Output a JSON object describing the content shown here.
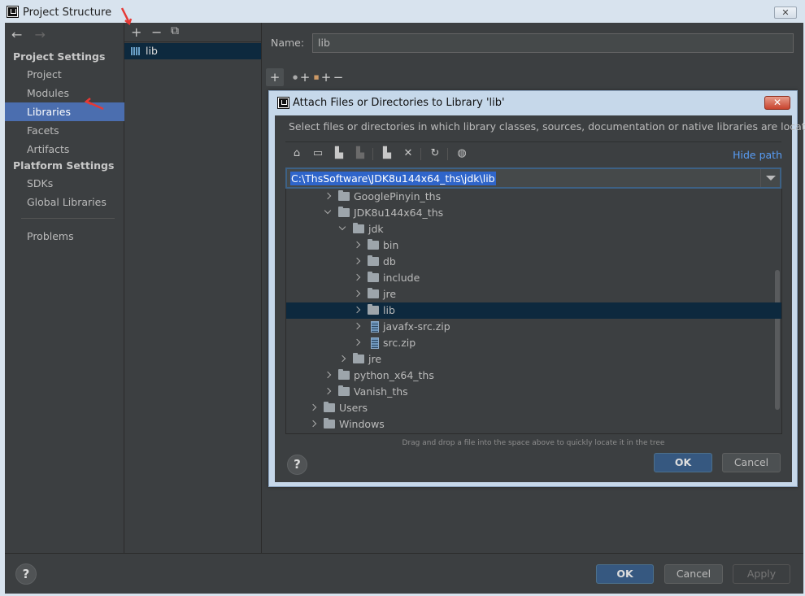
{
  "outer": {
    "title": "Project Structure",
    "close_glyph": "✕"
  },
  "sidebar": {
    "back_glyph": "←",
    "forward_glyph": "→",
    "project_settings_header": "Project Settings",
    "platform_settings_header": "Platform Settings",
    "items": [
      {
        "label": "Project"
      },
      {
        "label": "Modules"
      },
      {
        "label": "Libraries",
        "selected": true
      },
      {
        "label": "Facets"
      },
      {
        "label": "Artifacts"
      },
      {
        "label": "SDKs"
      },
      {
        "label": "Global Libraries"
      },
      {
        "label": "Problems"
      }
    ]
  },
  "middle": {
    "add_glyph": "+",
    "remove_glyph": "−",
    "copy_glyph": "⧉",
    "library_name": "lib"
  },
  "right": {
    "name_label": "Name:",
    "name_value": "lib",
    "toolbar": {
      "add_glyph": "+",
      "add_alt_glyph": "+",
      "add_other_glyph": "+",
      "remove_glyph": "−"
    }
  },
  "dialog": {
    "title": "Attach Files or Directories to Library 'lib'",
    "close_glyph": "✕",
    "description": "Select files or directories in which library classes, sources, documentation or native libraries are located",
    "hide_path": "Hide path",
    "path_value": "C:\\ThsSoftware\\JDK8u144x64_ths\\jdk\\lib",
    "toolbar_icons": [
      "home-icon",
      "desktop-icon",
      "project-folder-icon",
      "module-folder-icon",
      "new-folder-icon",
      "delete-icon",
      "refresh-icon",
      "show-hidden-icon"
    ],
    "tree": [
      {
        "label": "GooglePinyin_ths",
        "level": 2,
        "type": "folder",
        "open": false
      },
      {
        "label": "JDK8u144x64_ths",
        "level": 2,
        "type": "folder",
        "open": true
      },
      {
        "label": "jdk",
        "level": 3,
        "type": "folder",
        "open": true
      },
      {
        "label": "bin",
        "level": 4,
        "type": "folder",
        "open": false
      },
      {
        "label": "db",
        "level": 4,
        "type": "folder",
        "open": false
      },
      {
        "label": "include",
        "level": 4,
        "type": "folder",
        "open": false
      },
      {
        "label": "jre",
        "level": 4,
        "type": "folder",
        "open": false
      },
      {
        "label": "lib",
        "level": 4,
        "type": "folder",
        "open": false,
        "selected": true
      },
      {
        "label": "javafx-src.zip",
        "level": 4,
        "type": "zip",
        "open": false
      },
      {
        "label": "src.zip",
        "level": 4,
        "type": "zip",
        "open": false
      },
      {
        "label": "jre",
        "level": 3,
        "type": "folder",
        "open": false
      },
      {
        "label": "python_x64_ths",
        "level": 2,
        "type": "folder",
        "open": false
      },
      {
        "label": "Vanish_ths",
        "level": 2,
        "type": "folder",
        "open": false
      },
      {
        "label": "Users",
        "level": 1,
        "type": "folder",
        "open": false
      },
      {
        "label": "Windows",
        "level": 1,
        "type": "folder",
        "open": false
      }
    ],
    "drag_hint": "Drag and drop a file into the space above to quickly locate it in the tree",
    "help_glyph": "?",
    "ok_label": "OK",
    "cancel_label": "Cancel"
  },
  "bottom": {
    "help_glyph": "?",
    "ok_label": "OK",
    "cancel_label": "Cancel",
    "apply_label": "Apply"
  },
  "colors": {
    "selection": "#4b6eaf",
    "tree_selection": "#0d293e",
    "link": "#589df6",
    "annotation_arrow": "#e53935"
  }
}
